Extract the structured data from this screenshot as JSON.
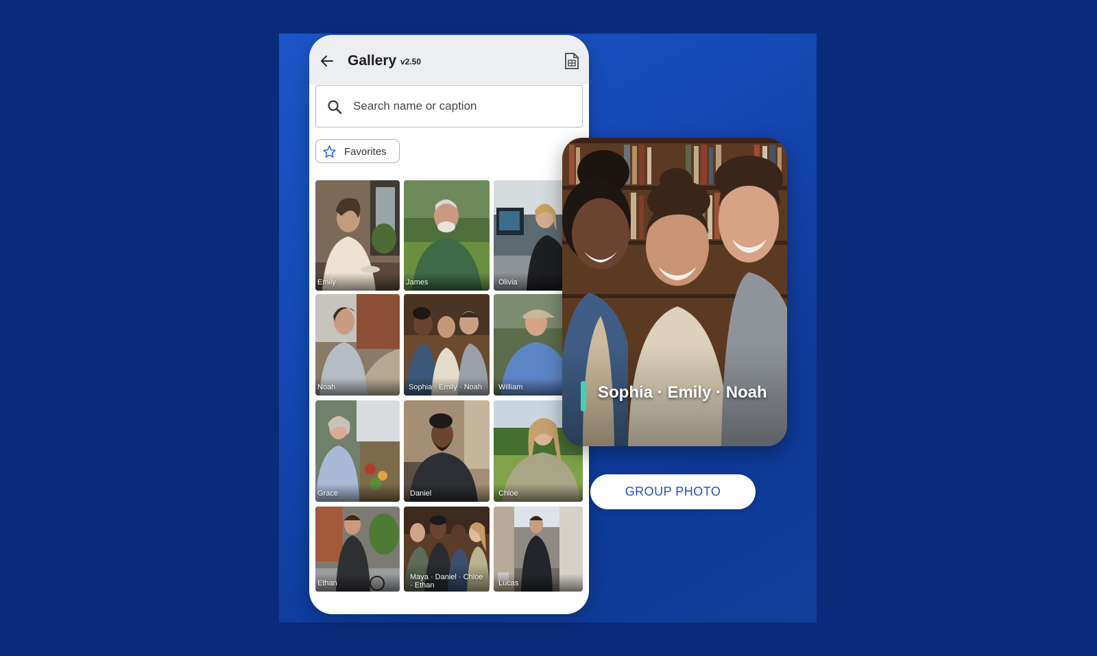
{
  "header": {
    "title": "Gallery",
    "version": "v2.50",
    "back_icon": "arrow-left-icon",
    "doc_icon": "document-icon"
  },
  "search": {
    "placeholder": "Search name or caption",
    "icon": "search-icon"
  },
  "filter": {
    "favorites_label": "Favorites",
    "icon": "star-outline-icon"
  },
  "gallery": {
    "tiles": [
      {
        "caption": "Emily"
      },
      {
        "caption": "James"
      },
      {
        "caption": "Olivia"
      },
      {
        "caption": "Noah"
      },
      {
        "caption": "Sophia · Emily · Noah"
      },
      {
        "caption": "William"
      },
      {
        "caption": "Grace"
      },
      {
        "caption": "Daniel"
      },
      {
        "caption": "Chloe"
      },
      {
        "caption": "Ethan"
      },
      {
        "caption": "Maya · Daniel · Chloe · Ethan"
      },
      {
        "caption": "Lucas"
      }
    ]
  },
  "detail": {
    "caption": "Sophia · Emily · Noah"
  },
  "action": {
    "group_label": "GROUP PHOTO"
  },
  "colors": {
    "background": "#0a2b7a",
    "accent": "#3fd1b4",
    "button_text": "#1f52b8"
  }
}
